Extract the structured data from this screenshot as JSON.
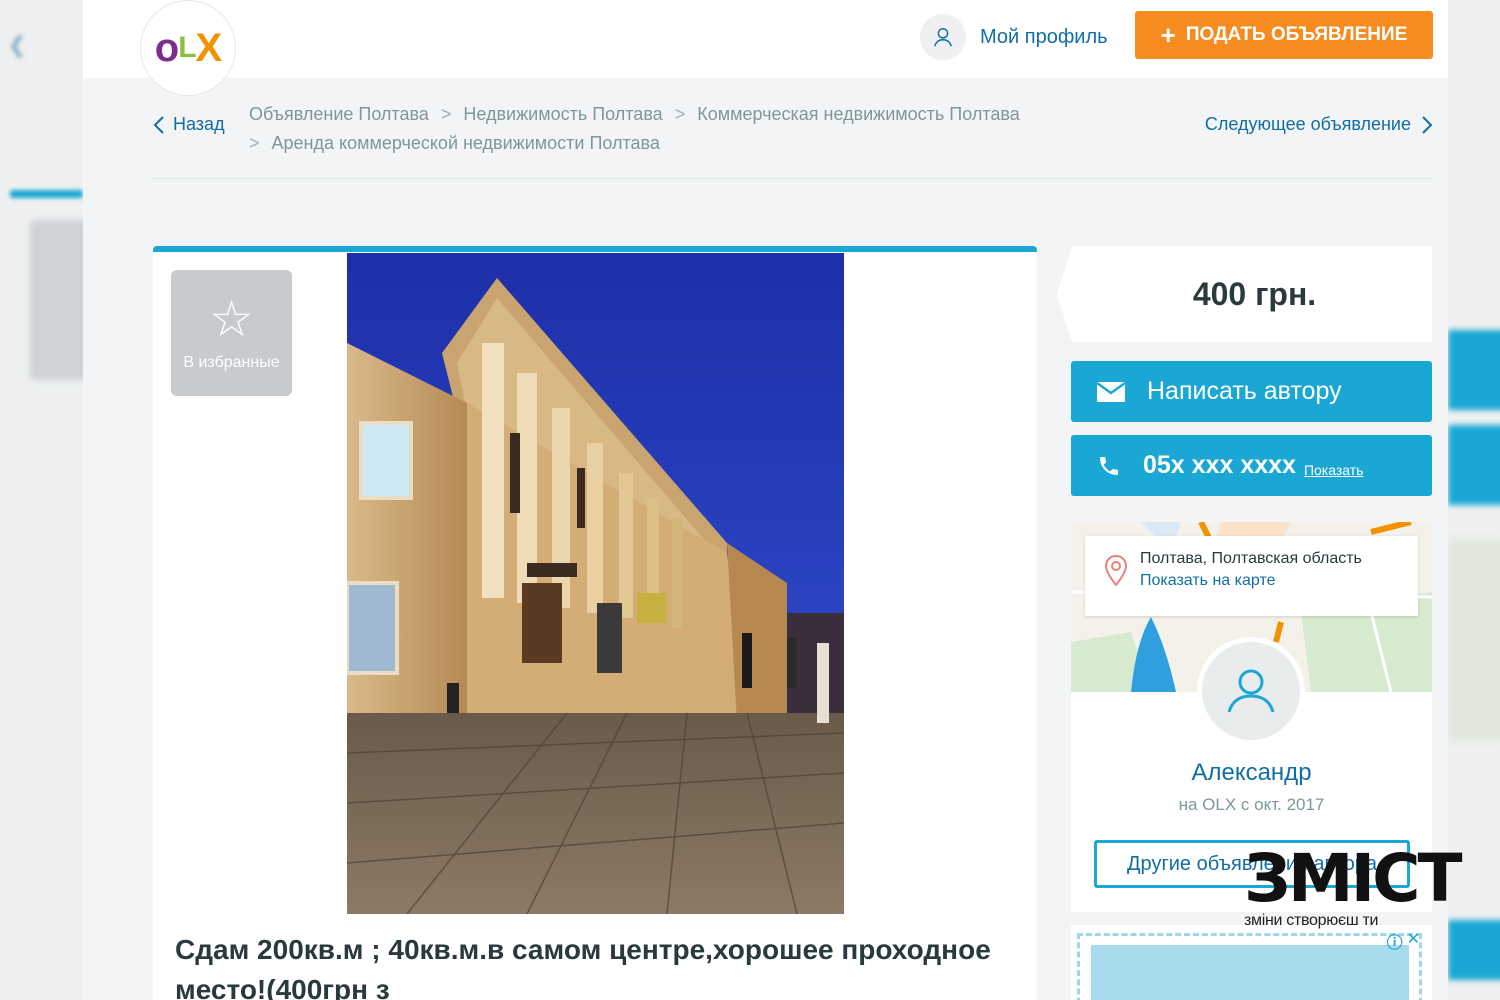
{
  "header": {
    "logo": "OLX",
    "profile_label": "Мой профиль",
    "post_button_label": "ПОДАТЬ ОБЪЯВЛЕНИЕ",
    "post_button_icon": "plus-icon"
  },
  "nav": {
    "back_label": "Назад",
    "breadcrumbs": [
      "Объявление Полтава",
      "Недвижимость Полтава",
      "Коммерческая недвижимость Полтава",
      "Аренда коммерческой недвижимости Полтава"
    ],
    "next_label": "Следующее объявление"
  },
  "listing": {
    "favorite_label": "В избранные",
    "title": "Сдам 200кв.м ; 40кв.м.в самом центре,хорошее проходное место!(400грн з",
    "photo_description": "building-photo"
  },
  "sidebar": {
    "price": "400 грн.",
    "write_author_label": "Написать автору",
    "phone_masked": "05x xxx xxxx",
    "phone_show_label": "Показать",
    "location": "Полтава, Полтавская область",
    "show_on_map_label": "Показать на карте",
    "seller_name": "Александр",
    "seller_since": "на OLX с окт. 2017",
    "other_ads_label": "Другие объявления автора"
  },
  "watermark": {
    "logo": "ЗМІСТ",
    "tagline": "зміни створюєш ти"
  },
  "colors": {
    "accent_blue": "#1aa7d4",
    "link_blue": "#116ea3",
    "orange": "#f68b1f"
  }
}
